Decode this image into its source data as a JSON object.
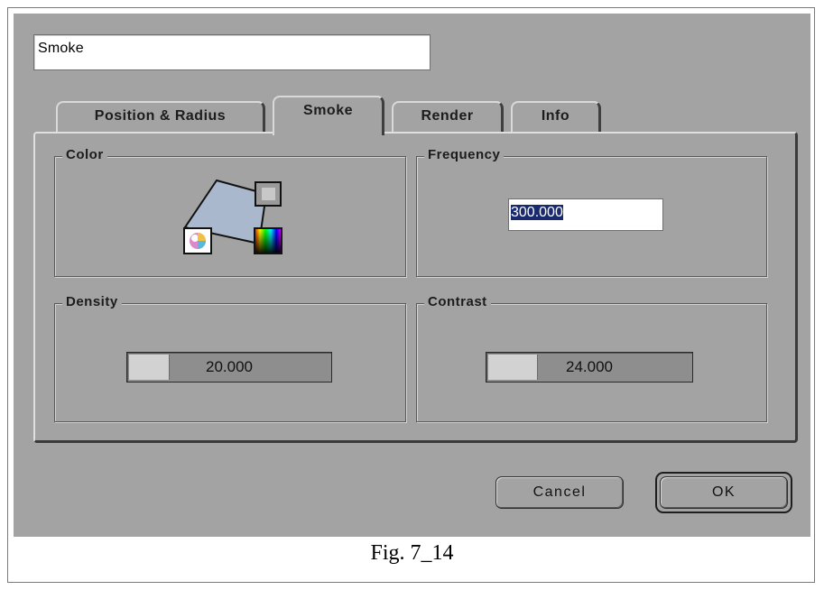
{
  "effect_name": "Smoke",
  "tabs": [
    {
      "label": "Position & Radius",
      "active": false
    },
    {
      "label": "Smoke",
      "active": true
    },
    {
      "label": "Render",
      "active": false
    },
    {
      "label": "Info",
      "active": false
    }
  ],
  "groups": {
    "color": {
      "title": "Color"
    },
    "frequency": {
      "title": "Frequency",
      "value": "300.000"
    },
    "density": {
      "title": "Density",
      "value": "20.000",
      "fill_fraction": 0.2
    },
    "contrast": {
      "title": "Contrast",
      "value": "24.000",
      "fill_fraction": 0.24
    }
  },
  "buttons": {
    "cancel": "Cancel",
    "ok": "OK"
  },
  "caption": "Fig. 7_14",
  "colors": {
    "dialog_bg": "#a3a3a3",
    "selection": "#1a2a6e",
    "color_swatch": "#a9b8cc"
  }
}
